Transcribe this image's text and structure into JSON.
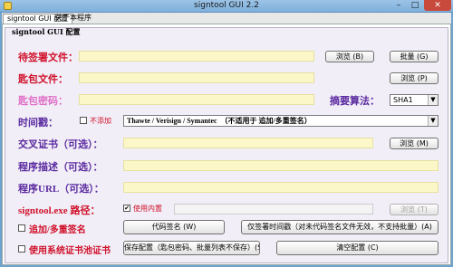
{
  "window": {
    "title": "signtool GUI 2.2",
    "min": "–",
    "max": "□",
    "close": "✕"
  },
  "tabs": [
    {
      "label": "signtool GUI 配置"
    },
    {
      "label": "关于本程序"
    }
  ],
  "panel": {
    "title": "signtool GUI 配置"
  },
  "rows": {
    "sign_file": {
      "label": "待签署文件：",
      "value": "",
      "button": "浏览 (B)"
    },
    "key_file": {
      "label": "匙包文件：",
      "value": "",
      "button": "浏览 (P)"
    },
    "key_password": {
      "label": "匙包密码：",
      "value": ""
    },
    "digest": {
      "label": "摘要算法：",
      "selected": "SHA1"
    },
    "timestamp": {
      "label": "时间戳：",
      "checkbox_label": "不添加",
      "checked": false,
      "selected": "Thawte / Verisign / Symantec　（不适用于 追加/多重签名）"
    },
    "cross_cert": {
      "label": "交叉证书（可选）：",
      "value": "",
      "button": "浏览 (M)"
    },
    "description": {
      "label": "程序描述（可选）：",
      "value": ""
    },
    "url": {
      "label": "程序URL（可选）：",
      "value": ""
    },
    "signtool_path": {
      "label": "signtool.exe 路径：",
      "checkbox_label": "使用内置",
      "checked": true,
      "value": "",
      "button": "浏览 (T)"
    }
  },
  "options": {
    "append_sign": {
      "label": "追加/多重签名",
      "checked": false
    },
    "system_store": {
      "label": "使用系统证书池证书",
      "checked": false
    }
  },
  "actions": {
    "sign_code": "代码签名 (W)",
    "timestamp_only": "仅签署时间戳（对未代码签名文件无效，不支持批量）(A)",
    "save_config": "保存配置（匙包密码、批量列表不保存）(S)",
    "clear_config": "清空配置 (C)"
  },
  "batch_button": "批量 (G)",
  "checkmark": "✔",
  "dropdown_arrow": "▼"
}
